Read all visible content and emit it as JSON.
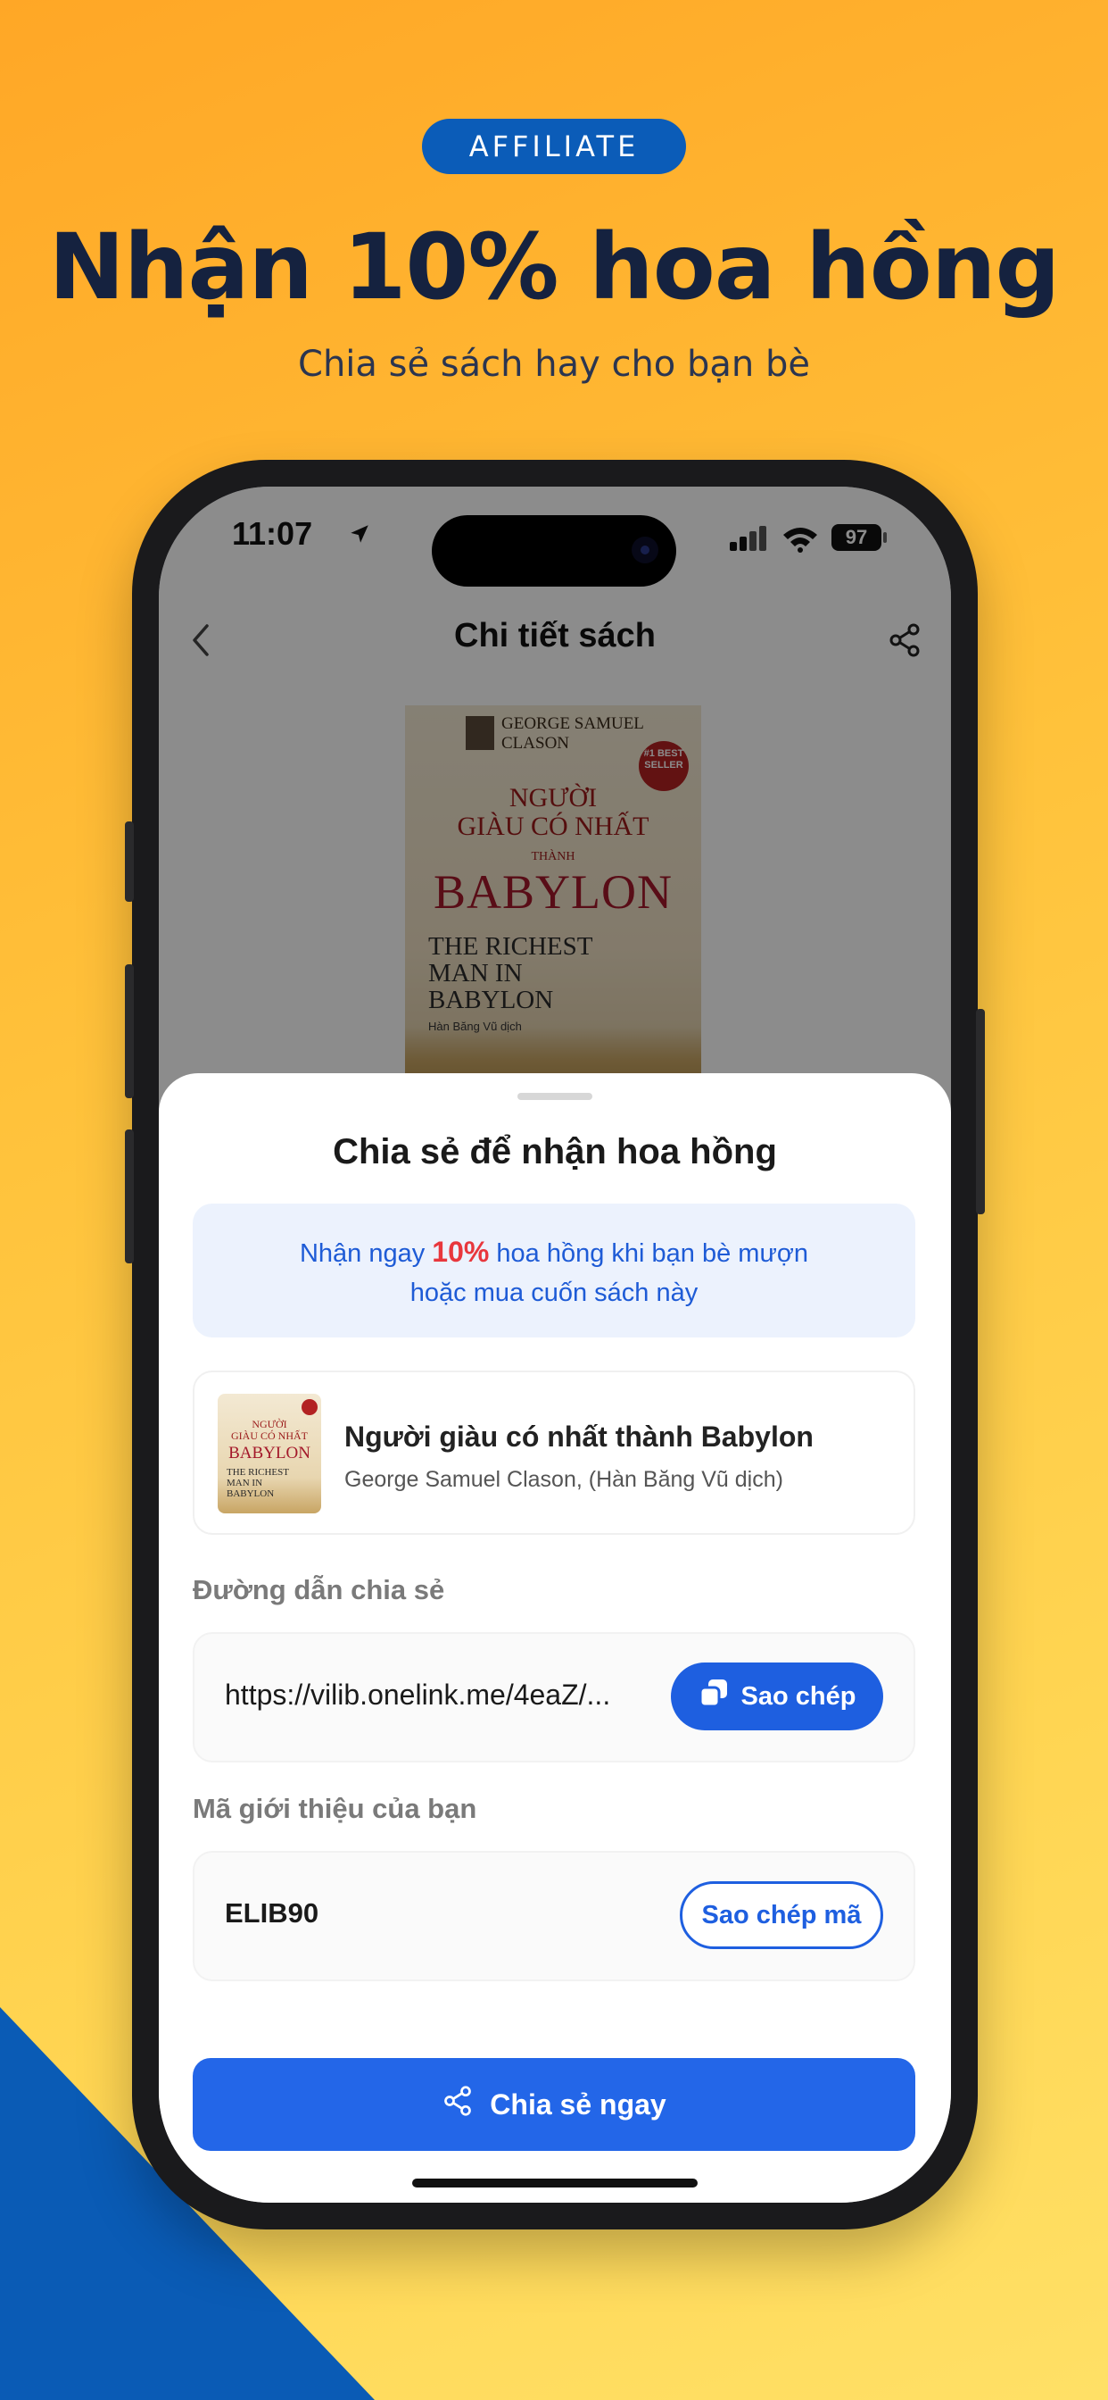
{
  "promo": {
    "badge": "AFFILIATE",
    "headline": "Nhận 10% hoa hồng",
    "subheadline": "Chia sẻ sách hay cho bạn bè"
  },
  "status_bar": {
    "time": "11:07",
    "battery": "97",
    "icons": [
      "location-arrow-icon",
      "signal-icon",
      "wifi-icon",
      "battery-icon"
    ]
  },
  "nav": {
    "title": "Chi tiết sách",
    "back_icon": "chevron-left-icon",
    "share_icon": "share-icon"
  },
  "cover": {
    "author": "GEORGE SAMUEL CLASON",
    "badge": "#1 BEST SELLER",
    "title_vi_line1": "NGƯỜI",
    "title_vi_line2": "GIÀU CÓ NHẤT",
    "title_vi_line3": "THÀNH",
    "title_vi_big": "BABYLON",
    "title_en_line1": "THE RICHEST",
    "title_en_line2": "MAN IN",
    "title_en_line3": "BABYLON",
    "translator": "Hàn Băng Vũ dịch"
  },
  "sheet": {
    "title": "Chia sẻ để nhận hoa hồng",
    "promo_pre": "Nhận ngay ",
    "promo_pct": "10%",
    "promo_post": " hoa hồng khi bạn bè mượn",
    "promo_line2": "hoặc mua cuốn sách này",
    "book": {
      "title": "Người giàu có nhất thành Babylon",
      "author": "George Samuel Clason, (Hàn Băng Vũ dịch)"
    },
    "link_label": "Đường dẫn chia sẻ",
    "link_value": "https://vilib.onelink.me/4eaZ/...",
    "copy_button": "Sao chép",
    "code_label": "Mã giới thiệu của bạn",
    "code_value": "ELIB90",
    "copy_code_button": "Sao chép mã",
    "share_button": "Chia sẻ ngay"
  },
  "colors": {
    "accent_blue": "#1E5FE0",
    "highlight_red": "#E8373D",
    "background_yellow": "#FFC23B"
  }
}
